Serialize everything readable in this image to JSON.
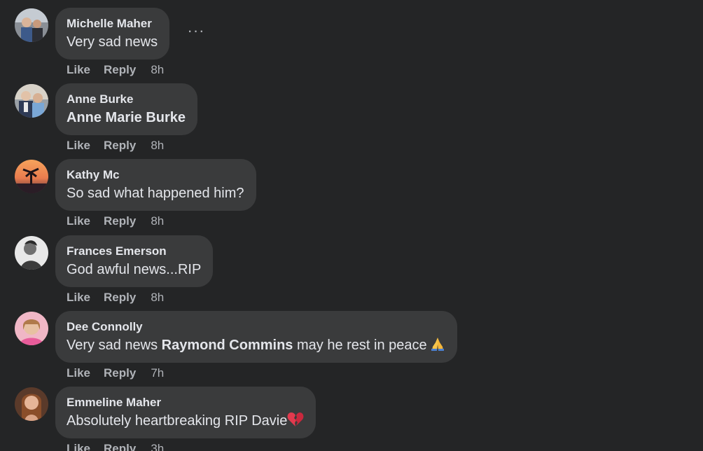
{
  "comments": [
    {
      "author": "Michelle Maher",
      "text": "Very sad news",
      "actions": {
        "like": "Like",
        "reply": "Reply",
        "time": "8h"
      },
      "more_label": "···"
    },
    {
      "author": "Anne Burke",
      "text": "Anne Marie Burke",
      "actions": {
        "like": "Like",
        "reply": "Reply",
        "time": "8h"
      }
    },
    {
      "author": "Kathy Mc",
      "text": "So sad what happened him?",
      "actions": {
        "like": "Like",
        "reply": "Reply",
        "time": "8h"
      }
    },
    {
      "author": "Frances Emerson",
      "text": "God awful news...RIP",
      "actions": {
        "like": "Like",
        "reply": "Reply",
        "time": "8h"
      }
    },
    {
      "author": "Dee Connolly",
      "text_before": "Very sad news ",
      "mention": "Raymond Commins",
      "text_after": " may he rest in peace",
      "emoji": "folded-hands-emoji",
      "actions": {
        "like": "Like",
        "reply": "Reply",
        "time": "7h"
      }
    },
    {
      "author": "Emmeline Maher",
      "text": "Absolutely heartbreaking RIP Davie",
      "emoji": "broken-heart-emoji",
      "actions": {
        "like": "Like",
        "reply": "Reply",
        "time": "3h"
      }
    }
  ],
  "colors": {
    "background": "#242526",
    "bubble": "#3a3b3c",
    "primary_text": "#e4e6eb",
    "secondary_text": "#b0b3b8"
  }
}
